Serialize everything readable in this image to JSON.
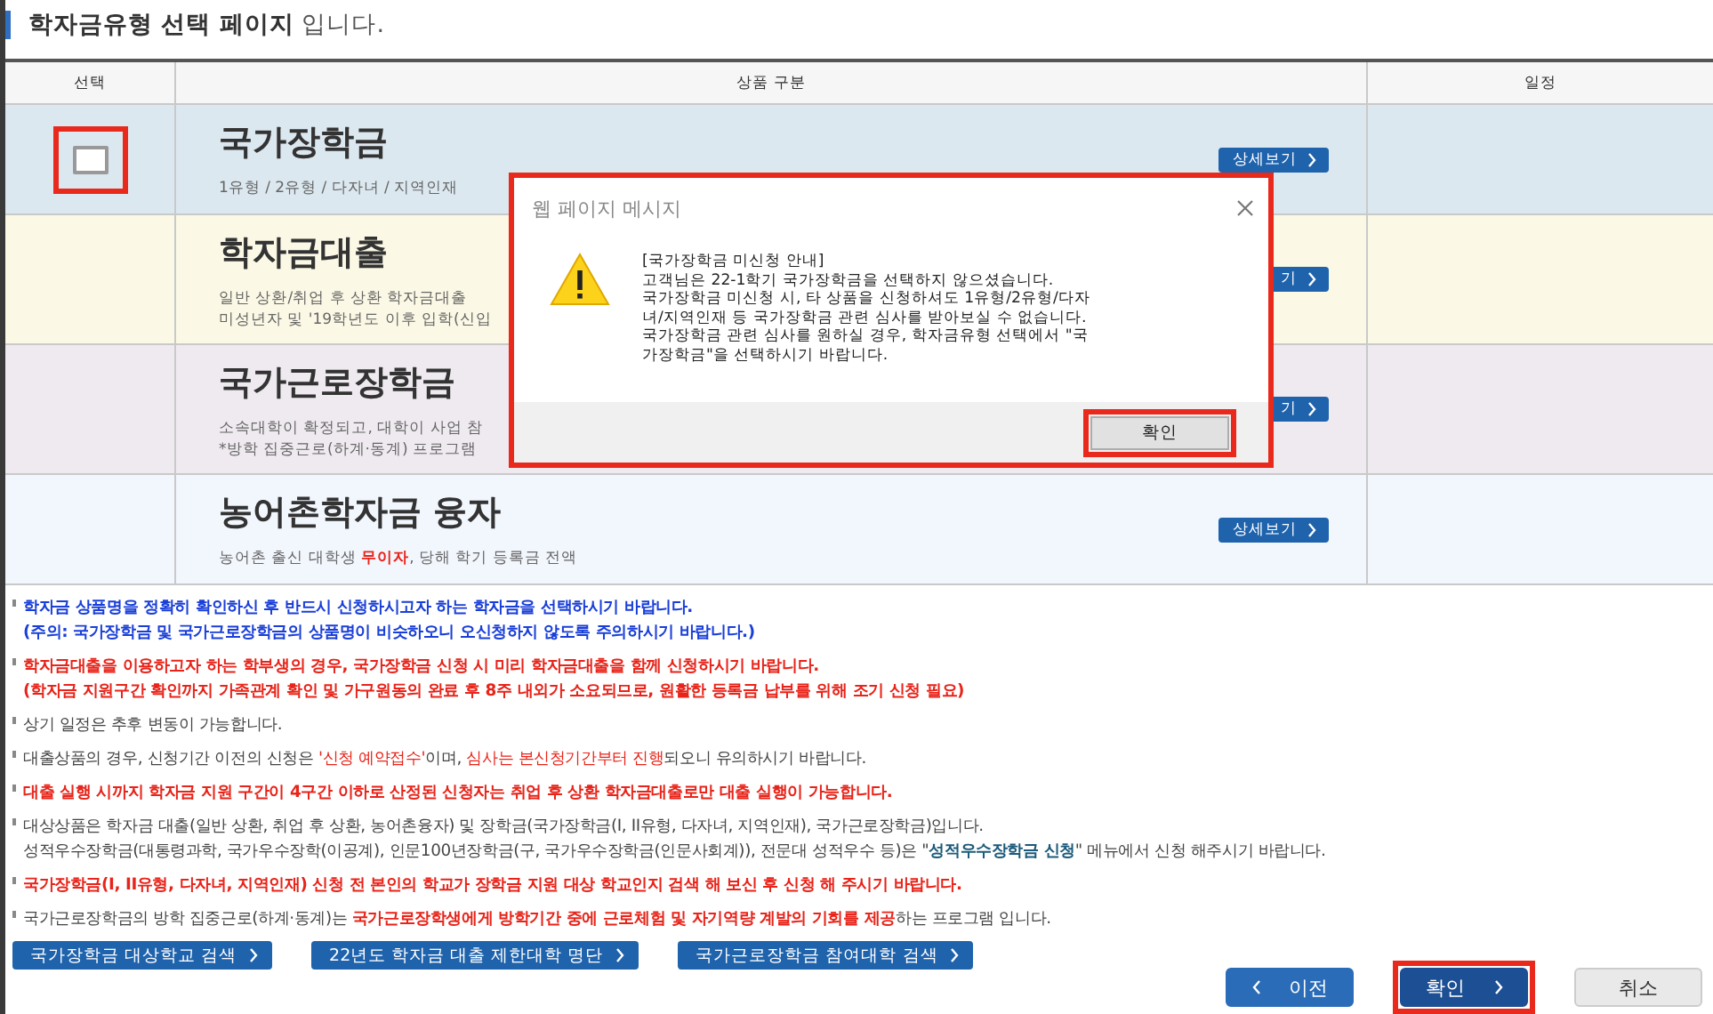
{
  "page_title": "**학자금유형 선택 페이지** 입니다.",
  "table": {
    "columns": [
      "선택",
      "상품 구분",
      "일정"
    ],
    "rows": [
      {
        "color": "#dce8f0",
        "checkbox": {
          "checked": false,
          "highlighted": true
        },
        "name": "국가장학금",
        "desc": [
          "1유형 / 2유형 / 다자녀 / 지역인재"
        ],
        "details": "상세보기"
      },
      {
        "color": "#fbf8e5",
        "name": "학자금대출",
        "desc": [
          "일반 상환/취업 후 상환 학자금대출",
          "미성년자 및 '19학년도 이후 입학(신입"
        ],
        "details": "기"
      },
      {
        "color": "#efeaf0",
        "name": "국가근로장학금",
        "desc": [
          "소속대학이 확정되고, 대학이 사업 참",
          "*방학 집중근로(하계·동계) 프로그램"
        ],
        "details": "기"
      },
      {
        "color": "#f2f6fd",
        "name": "농어촌학자금 융자",
        "desc": [
          "농어촌 출신 대학생 **무이자**, 당해 학기 등록금 전액"
        ],
        "details": "상세보기"
      }
    ]
  },
  "notes": [
    {
      "lines": [
        [
          {
            "text": "학자금 상품명을 정확히 확인하신 후 반드시 신청하시고자 하는 학자금을 선택하시기 바랍니다.",
            "color": "#1a3fd8",
            "bold": true
          }
        ],
        [
          {
            "text": "(주의: 국가장학금 및 국가근로장학금의 상품명이 비슷하오니 오신청하지 않도록 주의하시기 바랍니다.)",
            "color": "#1a3fd8",
            "bold": true
          }
        ]
      ]
    },
    {
      "lines": [
        [
          {
            "text": "학자금대출을 이용하고자 하는 학부생의 경우, 국가장학금 신청 시 미리 학자금대출을 함께 신청하시기 바랍니다.",
            "color": "#e8241a",
            "bold": true
          }
        ],
        [
          {
            "text": "(학자금 지원구간 확인까지 가족관계 확인 및 가구원동의 완료 후 8주 내외가 소요되므로, 원활한 등록금 납부를 위해 조기 신청 필요)",
            "color": "#e8241a",
            "bold": true
          }
        ]
      ]
    },
    {
      "lines": [
        [
          {
            "text": "상기 일정은 추후 변동이 가능합니다.",
            "color": "#444444",
            "bold": false
          }
        ]
      ]
    },
    {
      "lines": [
        [
          {
            "text": "대출상품의 경우, 신청기간 이전의 신청은 ",
            "color": "#444444",
            "bold": false
          },
          {
            "text": "'신청 예약접수'",
            "color": "#e8241a",
            "bold": false
          },
          {
            "text": "이며, ",
            "color": "#444444",
            "bold": false
          },
          {
            "text": "심사는 본신청기간부터 진행",
            "color": "#e8241a",
            "bold": false
          },
          {
            "text": "되오니 유의하시기 바랍니다.",
            "color": "#444444",
            "bold": false
          }
        ]
      ]
    },
    {
      "lines": [
        [
          {
            "text": "대출 실행 시까지 학자금 지원 구간이 4구간 이하로 산정된 신청자는 취업 후 상환 학자금대출로만 대출 실행이 가능합니다.",
            "color": "#e8241a",
            "bold": true
          }
        ]
      ]
    },
    {
      "lines": [
        [
          {
            "text": "대상상품은 학자금 대출(일반 상환, 취업 후 상환, 농어촌융자) 및 장학금(국가장학금(I, II유형, 다자녀, 지역인재), 국가근로장학금)입니다.",
            "color": "#444444",
            "bold": false
          }
        ],
        [
          {
            "text": "성적우수장학금(대통령과학, 국가우수장학(이공계), 인문100년장학금(구, 국가우수장학금(인문사회계)), 전문대 성적우수 등)은 \"",
            "color": "#444444",
            "bold": false
          },
          {
            "text": "성적우수장학금 신청",
            "color": "#1b5a7a",
            "bold": true
          },
          {
            "text": "\" 메뉴에서 신청 해주시기 바랍니다.",
            "color": "#444444",
            "bold": false
          }
        ]
      ]
    },
    {
      "lines": [
        [
          {
            "text": "국가장학금(I, II유형, 다자녀, 지역인재) 신청 전 본인의 학교가 장학금 지원 대상 학교인지 검색 해 보신 후 신청 해 주시기 바랍니다.",
            "color": "#e8241a",
            "bold": true
          }
        ]
      ]
    },
    {
      "lines": [
        [
          {
            "text": "국가근로장학금의 방학 집중근로(하계·동계)는 ",
            "color": "#444444",
            "bold": false
          },
          {
            "text": "국가근로장학생에게 방학기간 중에 근로체험 및 자기역량 계발의 기회를 제공",
            "color": "#e8241a",
            "bold": true
          },
          {
            "text": "하는 프로그램 입니다.",
            "color": "#444444",
            "bold": false
          }
        ]
      ]
    }
  ],
  "links": [
    "국가장학금 대상학교 검색",
    "22년도 학자금 대출 제한대학 명단",
    "국가근로장학금 참여대학 검색"
  ],
  "actions": [
    {
      "kind": "prev",
      "label": "이전",
      "highlighted": false
    },
    {
      "kind": "next",
      "label": "확인",
      "highlighted": true
    },
    {
      "kind": "cancel",
      "label": "취소",
      "highlighted": false
    }
  ],
  "dialog": {
    "title": "웹 페이지 메시지",
    "highlighted": true,
    "message": [
      "[국가장학금 미신청 안내]",
      "고객님은 22-1학기 국가장학금을 선택하지 않으셨습니다.",
      "국가장학금 미신청 시, 타 상품을 신청하셔도 1유형/2유형/다자",
      "녀/지역인재 등 국가장학금 관련 심사를 받아보실 수 없습니다.",
      "국가장학금 관련 심사를 원하실 경우, 학자금유형 선택에서 \"국",
      "가장학금\"을 선택하시기 바랍니다."
    ],
    "ok": {
      "label": "확인",
      "highlighted": true
    }
  }
}
